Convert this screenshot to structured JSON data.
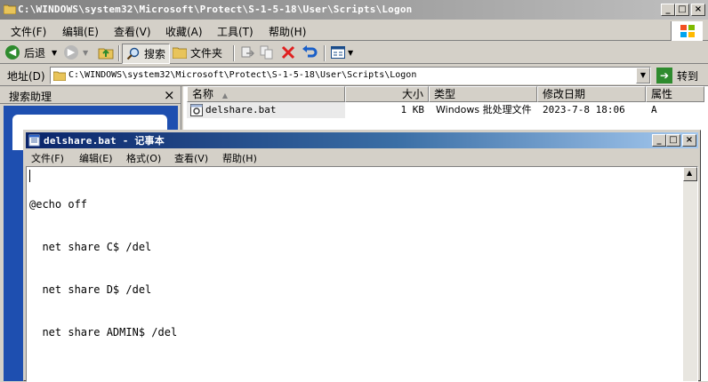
{
  "explorer": {
    "title": "C:\\WINDOWS\\system32\\Microsoft\\Protect\\S-1-5-18\\User\\Scripts\\Logon",
    "menu": [
      "文件(F)",
      "编辑(E)",
      "查看(V)",
      "收藏(A)",
      "工具(T)",
      "帮助(H)"
    ],
    "toolbar": {
      "back_label": "后退",
      "search_label": "搜索",
      "folders_label": "文件夹"
    },
    "address": {
      "label": "地址(D)",
      "value": "C:\\WINDOWS\\system32\\Microsoft\\Protect\\S-1-5-18\\User\\Scripts\\Logon",
      "go_label": "转到"
    },
    "search_pane": {
      "title": "搜索助理",
      "close_glyph": "×"
    },
    "columns": [
      "名称",
      "大小",
      "类型",
      "修改日期",
      "属性"
    ],
    "files": [
      {
        "name": "delshare.bat",
        "size": "1 KB",
        "type": "Windows 批处理文件",
        "modified": "2023-7-8 18:06",
        "attributes": "A"
      }
    ]
  },
  "notepad": {
    "title": "delshare.bat - 记事本",
    "menu": [
      "文件(F)",
      "编辑(E)",
      "格式(O)",
      "查看(V)",
      "帮助(H)"
    ],
    "lines": [
      "@echo off",
      "  net share C$ /del",
      "  net share D$ /del",
      "  net share ADMIN$ /del"
    ]
  },
  "colors": {
    "title_active": "#0a246a",
    "title_gradient_end": "#a6caf0",
    "window_face": "#d4d0c8",
    "delete_red": "#e02020",
    "go_green": "#2e8b2e"
  },
  "icons": [
    "folder-icon",
    "back-icon",
    "forward-icon",
    "up-folder-icon",
    "search-icon",
    "folders-icon",
    "move-to-icon",
    "copy-to-icon",
    "delete-icon",
    "undo-icon",
    "views-icon",
    "windows-logo-icon",
    "go-arrow-icon",
    "batch-file-icon",
    "notepad-icon"
  ]
}
